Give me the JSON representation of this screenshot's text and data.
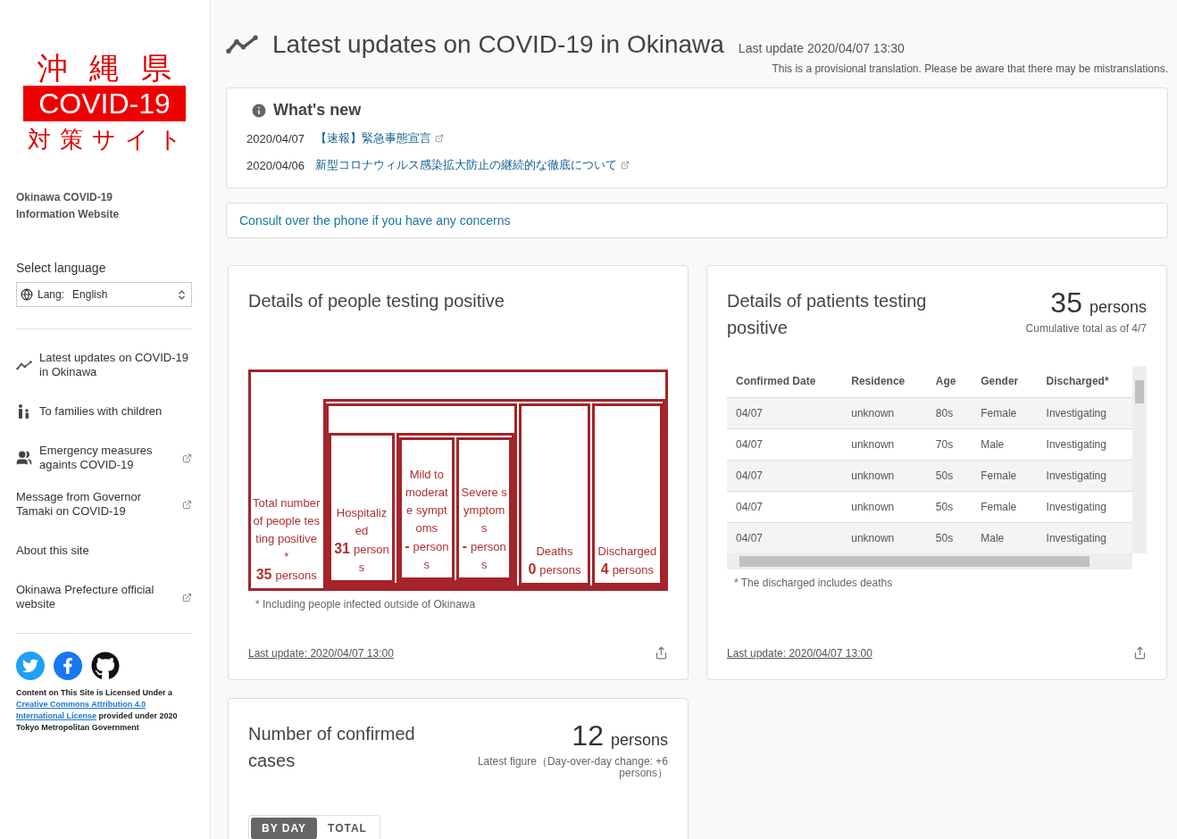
{
  "logo": {
    "top": "沖縄県",
    "badge": "COVID-19",
    "bottom": "対策サイト"
  },
  "site_name": "Okinawa COVID-19 Information Website",
  "language": {
    "label": "Select language",
    "field_label": "Lang:",
    "value": "English"
  },
  "nav": [
    {
      "label": "Latest updates on COVID-19 in Okinawa",
      "kind": "chart",
      "external": false
    },
    {
      "label": "To families with children",
      "kind": "family",
      "external": false
    },
    {
      "label": "Emergency measures againts COVID-19",
      "kind": "people",
      "external": true
    },
    {
      "label": "Message from Governor Tamaki on COVID-19",
      "kind": "plain",
      "external": true
    },
    {
      "label": "About this site",
      "kind": "plain",
      "external": false
    },
    {
      "label": "Okinawa Prefecture official website",
      "kind": "plain",
      "external": true
    }
  ],
  "social": [
    {
      "kind": "twitter"
    },
    {
      "kind": "facebook"
    },
    {
      "kind": "github"
    }
  ],
  "license": {
    "lead": "Content on This Site is Licensed Under a",
    "link_lines": [
      "Creative Commons Attribution 4.0",
      "International License"
    ],
    "tail": "provided under 2020 Tokyo Metropolitan Government"
  },
  "header": {
    "title": "Latest updates on COVID-19 in Okinawa",
    "last_update": "Last update 2020/04/07 13:30",
    "note": "This is a provisional translation. Please be aware that there may be mistranslations."
  },
  "whats_new": {
    "title": "What's new",
    "items": [
      {
        "date": "2020/04/07",
        "text": "【速報】緊急事態宣言"
      },
      {
        "date": "2020/04/06",
        "text": "新型コロナウィルス感染拡大防止の継続的な徹底について"
      }
    ]
  },
  "consult": "Consult over the phone if you have any concerns",
  "positive_card": {
    "title": "Details of people testing positive",
    "diagram": {
      "kind": "group",
      "children": [
        {
          "kind": "leaf",
          "label": "Total number of people testing positive *",
          "value": "35",
          "unit": "persons"
        },
        {
          "kind": "group",
          "children": [
            {
              "kind": "group",
              "children": [
                {
                  "kind": "leaf",
                  "label": "Hospitalized",
                  "value": "31",
                  "unit": "persons"
                },
                {
                  "kind": "group",
                  "children": [
                    {
                      "kind": "leaf",
                      "label": "Mild to moderate symptoms",
                      "value": "-",
                      "unit": "persons"
                    },
                    {
                      "kind": "leaf",
                      "label": "Severe symptoms",
                      "value": "-",
                      "unit": "persons"
                    }
                  ]
                }
              ]
            },
            {
              "kind": "leaf",
              "label": "Deaths",
              "value": "0",
              "unit": "persons"
            },
            {
              "kind": "leaf",
              "label": "Discharged",
              "value": "4",
              "unit": "persons"
            }
          ]
        }
      ]
    },
    "footnote": "* Including people infected outside of Okinawa",
    "last_update": "Last update: 2020/04/07 13:00"
  },
  "patients_card": {
    "title": "Details of patients testing positive",
    "count": "35",
    "unit": "persons",
    "sub": "Cumulative total as of 4/7",
    "columns": [
      "Confirmed Date",
      "Residence",
      "Age",
      "Gender",
      "Discharged*"
    ],
    "rows": [
      [
        "04/07",
        "unknown",
        "80s",
        "Female",
        "Investigating"
      ],
      [
        "04/07",
        "unknown",
        "70s",
        "Male",
        "Investigating"
      ],
      [
        "04/07",
        "unknown",
        "50s",
        "Female",
        "Investigating"
      ],
      [
        "04/07",
        "unknown",
        "50s",
        "Female",
        "Investigating"
      ],
      [
        "04/07",
        "unknown",
        "50s",
        "Male",
        "Investigating"
      ]
    ],
    "footnote": "* The discharged includes deaths",
    "last_update": "Last update: 2020/04/07 13:00"
  },
  "confirmed_card": {
    "title": "Number of confirmed cases",
    "count": "12",
    "unit": "persons",
    "sub": "Latest figure（Day-over-day change: +6 persons）",
    "tabs": [
      {
        "label": "BY DAY",
        "selected": true
      },
      {
        "label": "TOTAL",
        "selected": false
      }
    ]
  }
}
